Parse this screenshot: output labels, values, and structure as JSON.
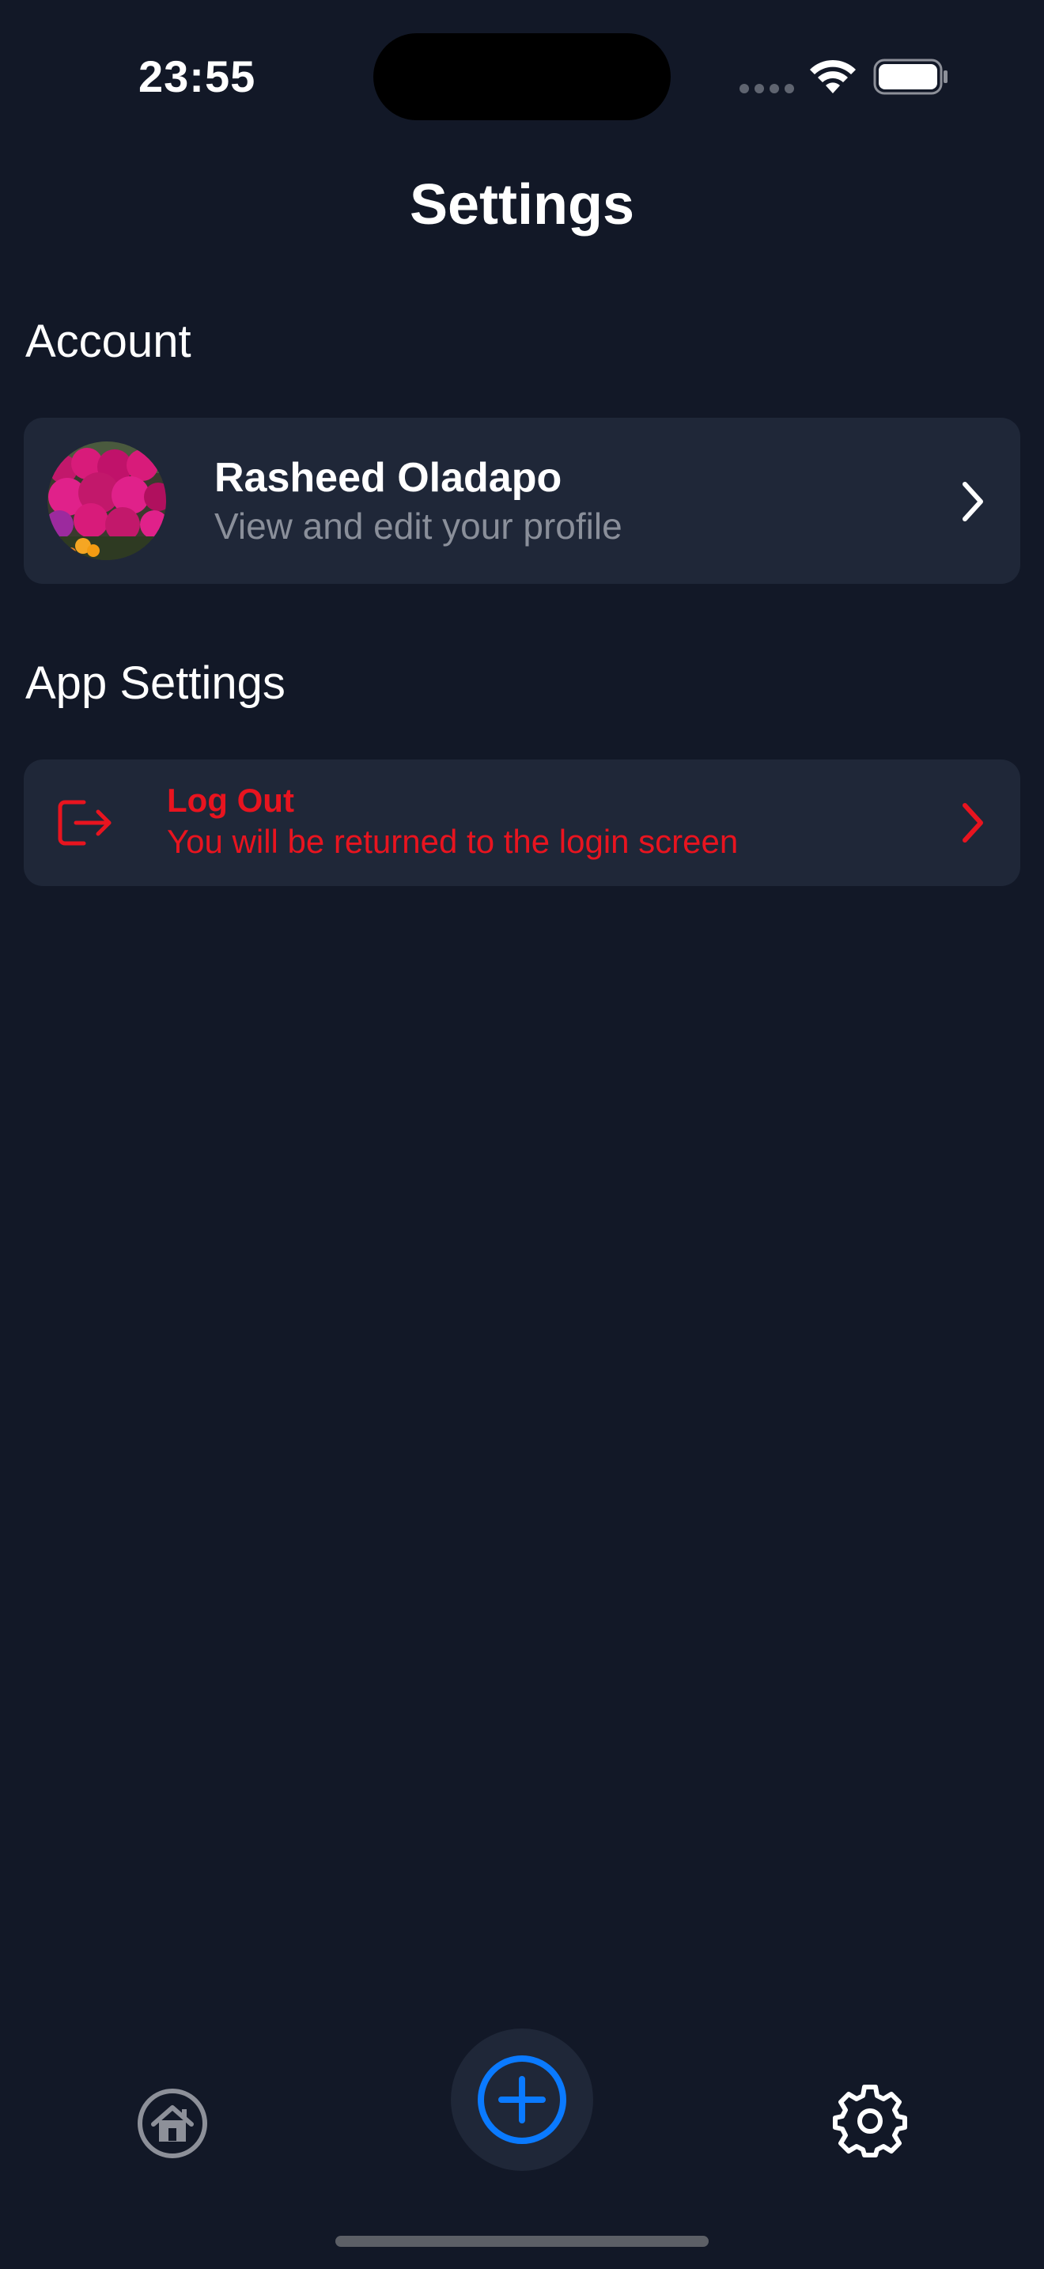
{
  "status_bar": {
    "time": "23:55"
  },
  "header": {
    "title": "Settings"
  },
  "sections": {
    "account": {
      "heading": "Account",
      "profile": {
        "name": "Rasheed Oladapo",
        "subtitle": "View and edit your profile"
      }
    },
    "app_settings": {
      "heading": "App Settings",
      "logout": {
        "title": "Log Out",
        "subtitle": "You will be returned to the login screen"
      }
    }
  },
  "tab_bar": {
    "items": [
      {
        "icon": "home-icon"
      },
      {
        "icon": "plus-circle-icon"
      },
      {
        "icon": "gear-icon"
      }
    ]
  },
  "colors": {
    "background": "#121827",
    "card": "#1f2738",
    "danger": "#e8141f",
    "accent": "#0a7aff",
    "muted_text": "#8a8f9a"
  }
}
